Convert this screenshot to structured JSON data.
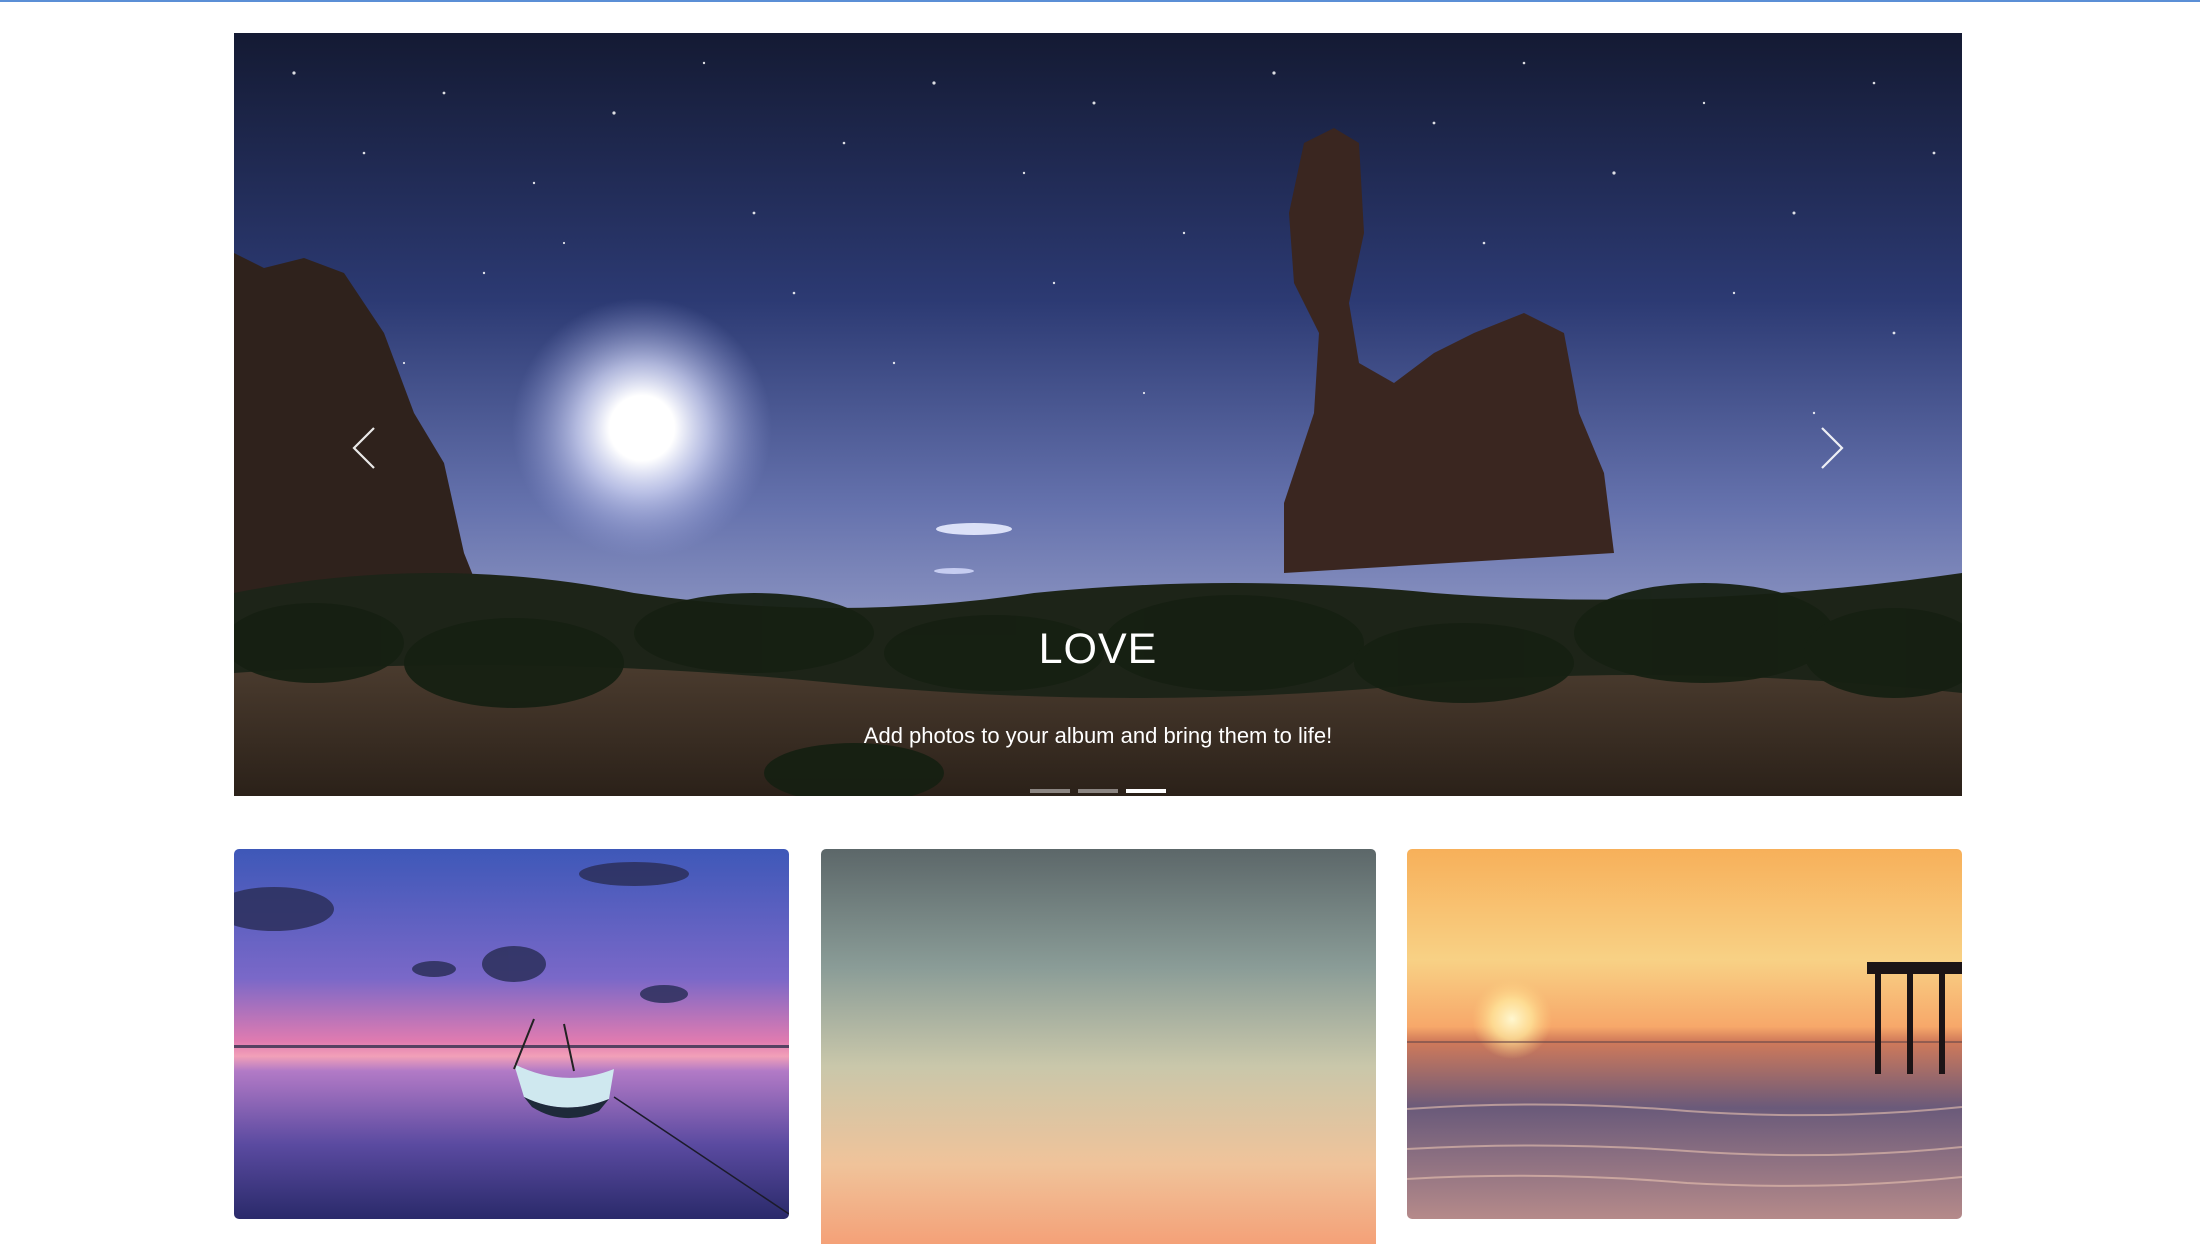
{
  "carousel": {
    "slide_title": "LOVE",
    "slide_text": "Add photos to your album and bring them to life!",
    "prev_icon": "chevron-left-icon",
    "next_icon": "chevron-right-icon",
    "indicator_count": 3,
    "active_indicator": 3
  },
  "gallery": {
    "items": [
      {
        "photo": "sunset-lake-boat"
      },
      {
        "photo": "gradient-sky"
      },
      {
        "photo": "beach-sunset-pier"
      }
    ]
  },
  "colors": {
    "top_rule": "#5b8fd6",
    "caption_text": "#ffffff"
  }
}
